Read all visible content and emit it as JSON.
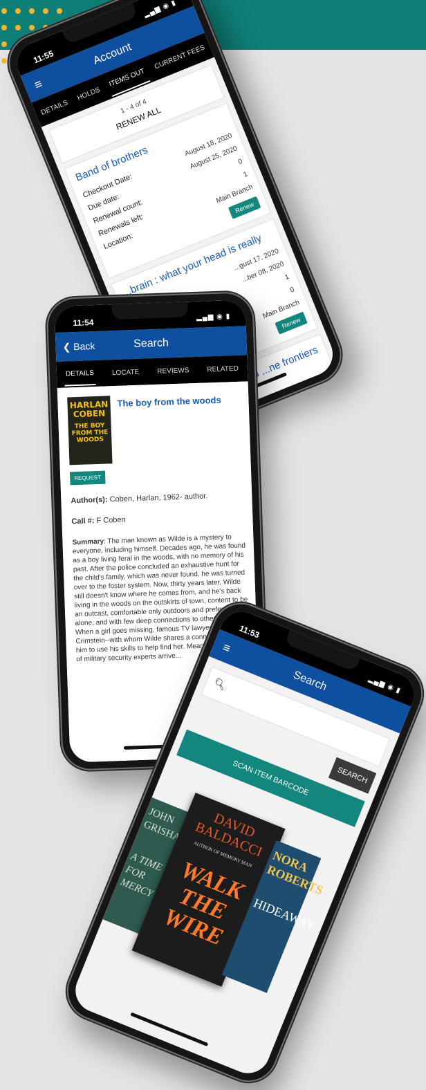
{
  "phone_account": {
    "time": "11:55",
    "title": "Account",
    "tabs": [
      "DETAILS",
      "HOLDS",
      "ITEMS OUT",
      "CURRENT FEES"
    ],
    "pagination": "1 - 4 of 4",
    "renew_all": "RENEW ALL",
    "items": [
      {
        "title": "Band of brothers",
        "labels": [
          "Checkout Date:",
          "Due date:",
          "Renewal count:",
          "Renewals left:",
          "Location:"
        ],
        "values": [
          "August 18, 2020",
          "August 25, 2020",
          "0",
          "1",
          "Main Branch"
        ],
        "renew": "Renew"
      },
      {
        "title": "...brain : what your head is really",
        "values": [
          "...gust 17, 2020",
          "...ber 08, 2020",
          "1",
          "0",
          "Main Branch"
        ],
        "renew": "Renew"
      },
      {
        "title": "...ealing : ...eries and ...ne frontiers of"
      }
    ]
  },
  "phone_details": {
    "time": "11:54",
    "back": "Back",
    "title": "Search",
    "tabs": [
      "DETAILS",
      "LOCATE",
      "REVIEWS",
      "RELATED"
    ],
    "book_title": "The boy from the woods",
    "cover": {
      "author": "HARLAN COBEN",
      "title": "THE BOY FROM THE WOODS"
    },
    "request": "REQUEST",
    "author_label": "Author(s):",
    "author": "Coben, Harlan, 1962- author.",
    "call_label": "Call #:",
    "call": "F Coben",
    "summary_label": "Summary",
    "summary": ": The man known as Wilde is a mystery to everyone, including himself. Decades ago, he was found as a boy living feral in the woods, with no memory of his past. After the police concluded an exhaustive hunt for the child's family, which was never found, he was turned over to the foster system. Now, thirty years later, Wilde still doesn't know where he comes from, and he's back living in the woods on the outskirts of town, content to be an outcast, comfortable only outdoors and preferably alone, and with few deep connections to other people. When a girl goes missing, famous TV lawyer Hester Crimstein--with whom Wilde shares a connection--asks him to use his skills to help find her. Meanwhile, a group of military security experts arrive..."
  },
  "phone_search": {
    "time": "11:53",
    "title": "Search",
    "search_placeholder": "",
    "search_button": "SEARCH",
    "scan_button": "SCAN ITEM BARCODE",
    "covers": [
      {
        "author": "JOHN GRISHAM",
        "title": "A TIME FOR MERCY"
      },
      {
        "author": "DAVID BALDACCI",
        "tagline": "AUTHOR OF MEMORY MAN",
        "title": "WALK THE WIRE"
      },
      {
        "author": "NORA ROBERTS",
        "title": "HIDEAWAY"
      }
    ]
  },
  "colors": {
    "teal_banner": "#0e8078",
    "header_blue": "#0f4f9f",
    "teal_button": "#13877d",
    "accent_dots": "#f2b530"
  },
  "icons": [
    "menu-icon",
    "back-chevron-icon",
    "search-icon",
    "signal-wifi-battery-icon"
  ]
}
